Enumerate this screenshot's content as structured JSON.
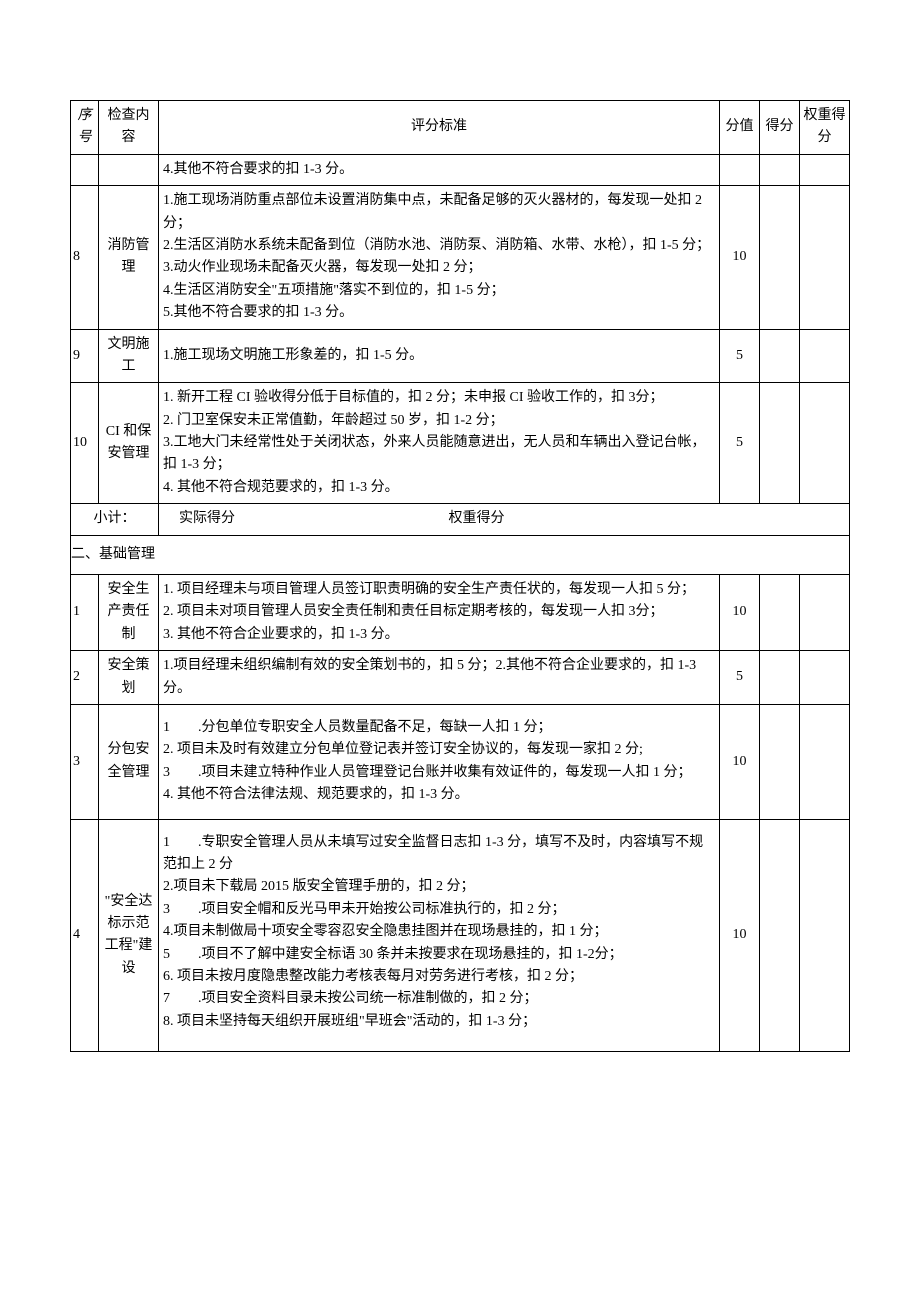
{
  "header": {
    "seq": "序号",
    "item": "检查内容",
    "criteria": "评分标准",
    "score": "分值",
    "got": "得分",
    "weight": "权重得分"
  },
  "rows": [
    {
      "seq": "",
      "item": "",
      "criteria": "4.其他不符合要求的扣 1-3 分。",
      "score": "",
      "got": "",
      "weight": ""
    },
    {
      "seq": "8",
      "item": "消防管理",
      "criteria": "1.施工现场消防重点部位未设置消防集中点，未配备足够的灭火器材的，每发现一处扣 2 分；\n2.生活区消防水系统未配备到位（消防水池、消防泵、消防箱、水带、水枪），扣 1-5 分；\n3.动火作业现场未配备灭火器，每发现一处扣 2 分；\n4.生活区消防安全\"五项措施\"落实不到位的，扣 1-5 分；\n5.其他不符合要求的扣 1-3 分。",
      "score": "10",
      "got": "",
      "weight": ""
    },
    {
      "seq": "9",
      "item": "文明施工",
      "criteria": "1.施工现场文明施工形象差的，扣 1-5 分。",
      "score": "5",
      "got": "",
      "weight": ""
    },
    {
      "seq": "10",
      "item": "CI 和保安管理",
      "criteria": "1. 新开工程 CI 验收得分低于目标值的，扣 2 分；未申报 CI 验收工作的，扣 3分；\n2. 门卫室保安未正常值勤，年龄超过 50 岁，扣 1-2 分；\n3.工地大门未经常性处于关闭状态，外来人员能随意进出，无人员和车辆出入登记台帐，扣 1-3 分；\n4. 其他不符合规范要求的，扣 1-3 分。",
      "score": "5",
      "got": "",
      "weight": ""
    }
  ],
  "subtotal": {
    "label": "小计：",
    "actual": "实际得分",
    "weight": "权重得分"
  },
  "section2": {
    "title": "二、基础管理",
    "rows": [
      {
        "seq": "1",
        "item": "安全生产责任制",
        "criteria": "1. 项目经理未与项目管理人员签订职责明确的安全生产责任状的，每发现一人扣 5 分；\n2. 项目未对项目管理人员安全责任制和责任目标定期考核的，每发现一人扣 3分；\n3. 其他不符合企业要求的，扣 1-3 分。",
        "score": "10",
        "got": "",
        "weight": ""
      },
      {
        "seq": "2",
        "item": "安全策划",
        "criteria": "1.项目经理未组织编制有效的安全策划书的，扣 5 分；2.其他不符合企业要求的，扣 1-3 分。",
        "score": "5",
        "got": "",
        "weight": ""
      },
      {
        "seq": "3",
        "item": "分包安全管理",
        "criteria": "1　　.分包单位专职安全人员数量配备不足，每缺一人扣 1 分；\n2. 项目未及时有效建立分包单位登记表并签订安全协议的，每发现一家扣 2 分;\n3　　.项目未建立特种作业人员管理登记台账并收集有效证件的，每发现一人扣 1 分；\n4. 其他不符合法律法规、规范要求的，扣 1-3 分。",
        "score": "10",
        "got": "",
        "weight": ""
      },
      {
        "seq": "4",
        "item": "\"安全达标示范工程\"建设",
        "criteria": "1　　.专职安全管理人员从未填写过安全监督日志扣 1-3 分，填写不及时，内容填写不规范扣上 2 分\n2.项目未下载局 2015 版安全管理手册的，扣 2 分；\n3　　.项目安全帽和反光马甲未开始按公司标准执行的，扣 2 分；\n4.项目未制做局十项安全零容忍安全隐患挂图并在现场悬挂的，扣 1 分；\n5　　.项目不了解中建安全标语 30 条并未按要求在现场悬挂的，扣 1-2分；\n6. 项目未按月度隐患整改能力考核表每月对劳务进行考核，扣 2 分；\n7　　.项目安全资料目录未按公司统一标准制做的，扣 2 分；\n8. 项目未坚持每天组织开展班组\"早班会\"活动的，扣 1-3 分；",
        "score": "10",
        "got": "",
        "weight": ""
      }
    ]
  }
}
